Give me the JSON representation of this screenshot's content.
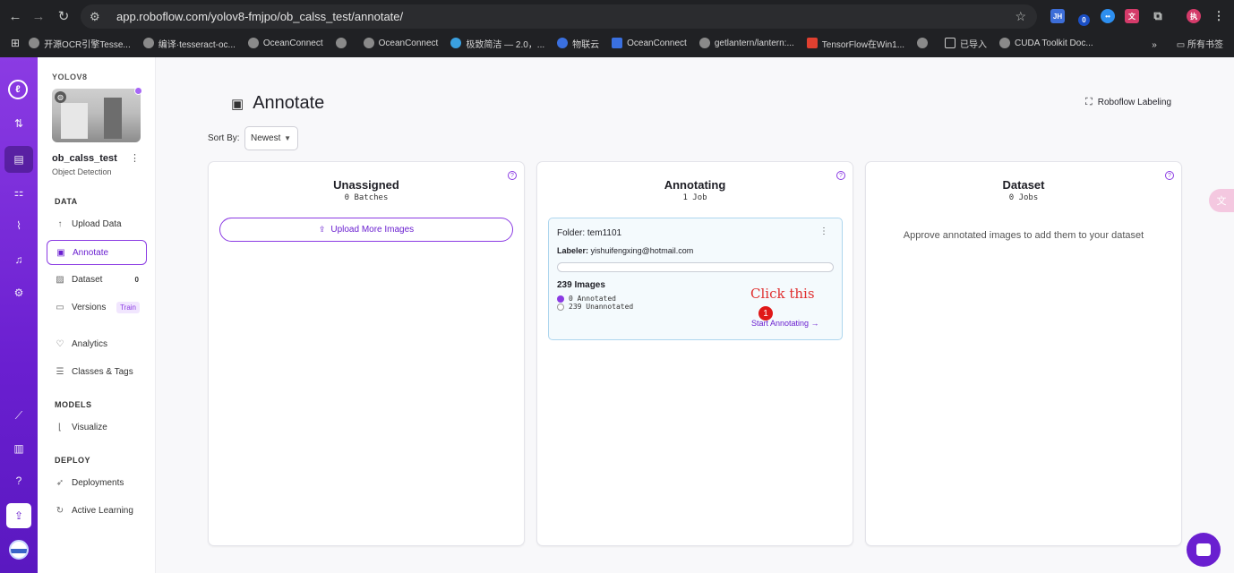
{
  "browser": {
    "url": "app.roboflow.com/yolov8-fmjpo/ob_calss_test/annotate/",
    "bookmarks": [
      "开源OCR引擎Tesse...",
      "编译·tesseract-oc...",
      "OceanConnect",
      "OceanConnect",
      "极致简洁 — 2.0，...",
      "物联云",
      "OceanConnect",
      "getlantern/lantern:...",
      "TensorFlow在Win1...",
      "已导入",
      "CUDA Toolkit Doc..."
    ],
    "bookmarks_right": "所有书签",
    "ext_badge": "0"
  },
  "sidebar": {
    "workspace": "YOLOV8",
    "project_name": "ob_calss_test",
    "project_type": "Object Detection",
    "sections": {
      "data": "DATA",
      "models": "MODELS",
      "deploy": "DEPLOY"
    },
    "items": [
      {
        "label": "Upload Data",
        "icon": "upload-icon"
      },
      {
        "label": "Annotate",
        "icon": "annotate-icon"
      },
      {
        "label": "Dataset",
        "icon": "image-icon",
        "badge": "0"
      },
      {
        "label": "Versions",
        "icon": "versions-icon",
        "badge": "Train"
      },
      {
        "label": "Analytics",
        "icon": "heart-icon"
      },
      {
        "label": "Classes & Tags",
        "icon": "list-icon"
      },
      {
        "label": "Visualize",
        "icon": "chart-icon"
      },
      {
        "label": "Deployments",
        "icon": "rocket-icon"
      },
      {
        "label": "Active Learning",
        "icon": "refresh-icon"
      }
    ]
  },
  "main": {
    "title": "Annotate",
    "labeling_link": "Roboflow Labeling",
    "sort_label": "Sort By:",
    "sort_value": "Newest",
    "columns": [
      {
        "title": "Unassigned",
        "subtitle": "0 Batches",
        "button": "Upload More Images"
      },
      {
        "title": "Annotating",
        "subtitle": "1 Job",
        "job": {
          "folder": "Folder: tem1101",
          "labeler_key": "Labeler:",
          "labeler_value": "yishuifengxing@hotmail.com",
          "progress": 0,
          "images": "239 Images",
          "annotated": "0 Annotated",
          "unannotated": "239 Unannotated",
          "action": "Start Annotating →",
          "note": "Click this",
          "marker": "1"
        }
      },
      {
        "title": "Dataset",
        "subtitle": "0 Jobs",
        "empty_message": "Approve annotated images to add them to your dataset"
      }
    ]
  },
  "colors": {
    "brand": "#8b3be3",
    "brand_dark": "#6a1fd0",
    "annotation": "#e01818"
  }
}
